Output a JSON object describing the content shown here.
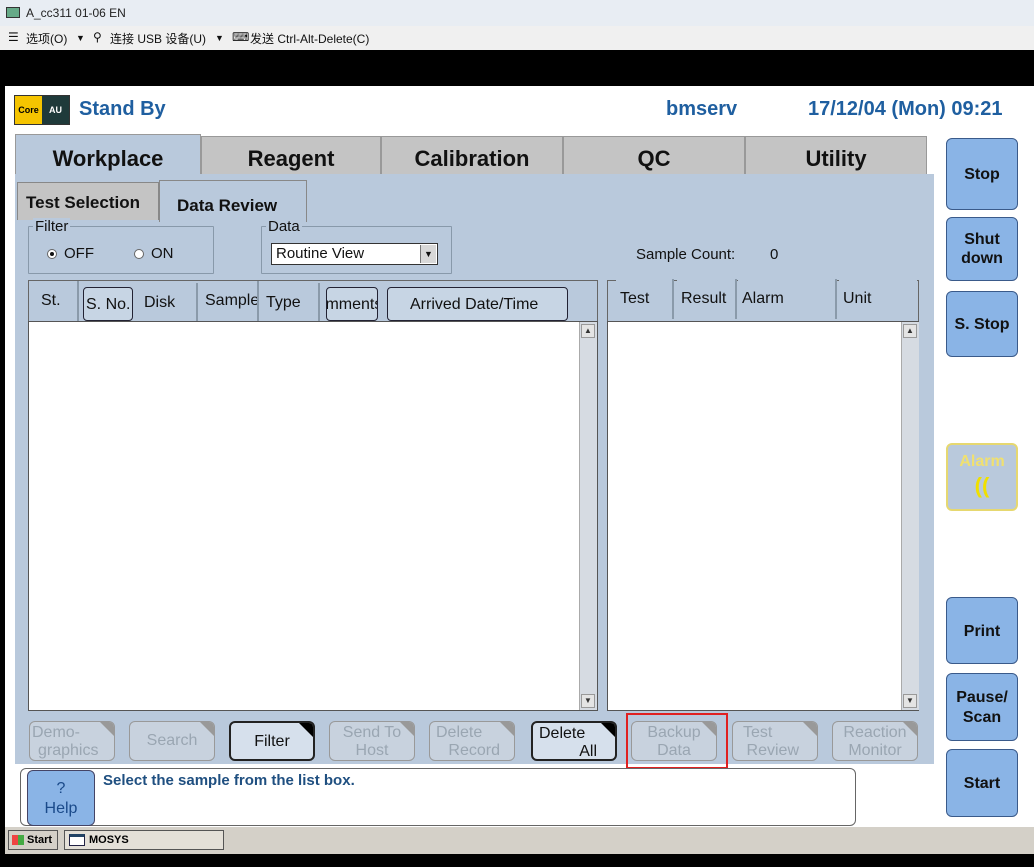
{
  "host": {
    "window_title": "A_cc311 01-06 EN",
    "menu": {
      "options": "选项(O)",
      "usb": "连接 USB 设备(U)",
      "send_cad": "发送 Ctrl-Alt-Delete(C)"
    }
  },
  "status": {
    "logo_core": "Core",
    "logo_au": "AU",
    "state": "Stand By",
    "user": "bmserv",
    "datetime": "17/12/04 (Mon) 09:21"
  },
  "main_tabs": [
    "Workplace",
    "Reagent",
    "Calibration",
    "QC",
    "Utility"
  ],
  "sub_tabs": [
    "Test Selection",
    "Data Review"
  ],
  "filter": {
    "legend": "Filter",
    "off_label": "OFF",
    "on_label": "ON",
    "selected": "OFF"
  },
  "data_group": {
    "legend": "Data",
    "selected": "Routine View"
  },
  "sample_count": {
    "label": "Sample Count:",
    "value": "0"
  },
  "sample_table": {
    "columns": [
      "St.",
      "S. No.",
      "Disk",
      "Sample",
      "Type",
      "Comments",
      "Arrived Date/Time"
    ]
  },
  "result_table": {
    "columns": [
      "Test",
      "Result",
      "Alarm",
      "Unit"
    ]
  },
  "function_buttons": [
    {
      "line1": "Demo-",
      "line2": "graphics",
      "enabled": false
    },
    {
      "line1": "Search",
      "line2": "",
      "enabled": false
    },
    {
      "line1": "Filter",
      "line2": "",
      "enabled": true
    },
    {
      "line1": "Send To",
      "line2": "Host",
      "enabled": false
    },
    {
      "line1": "Delete",
      "line2": "Record",
      "enabled": false
    },
    {
      "line1": "Delete",
      "line2": "All",
      "enabled": true
    },
    {
      "line1": "Backup",
      "line2": "Data",
      "enabled": false
    },
    {
      "line1": "Test",
      "line2": "Review",
      "enabled": false
    },
    {
      "line1": "Reaction",
      "line2": "Monitor",
      "enabled": false
    }
  ],
  "help": {
    "symbol": "?",
    "label": "Help"
  },
  "message": "Select the sample from the list box.",
  "side_buttons": {
    "stop": "Stop",
    "shutdown_1": "Shut",
    "shutdown_2": "down",
    "s_stop": "S. Stop",
    "alarm": "Alarm",
    "alarm_glyph": "((",
    "print": "Print",
    "pause_1": "Pause/",
    "pause_2": "Scan",
    "start": "Start"
  },
  "taskbar": {
    "start": "Start",
    "task": "MOSYS"
  },
  "colors": {
    "panel": "#b9c9dc",
    "side_button": "#8ab4e6",
    "status_text": "#1f5fa0",
    "highlight": "#e02020"
  }
}
